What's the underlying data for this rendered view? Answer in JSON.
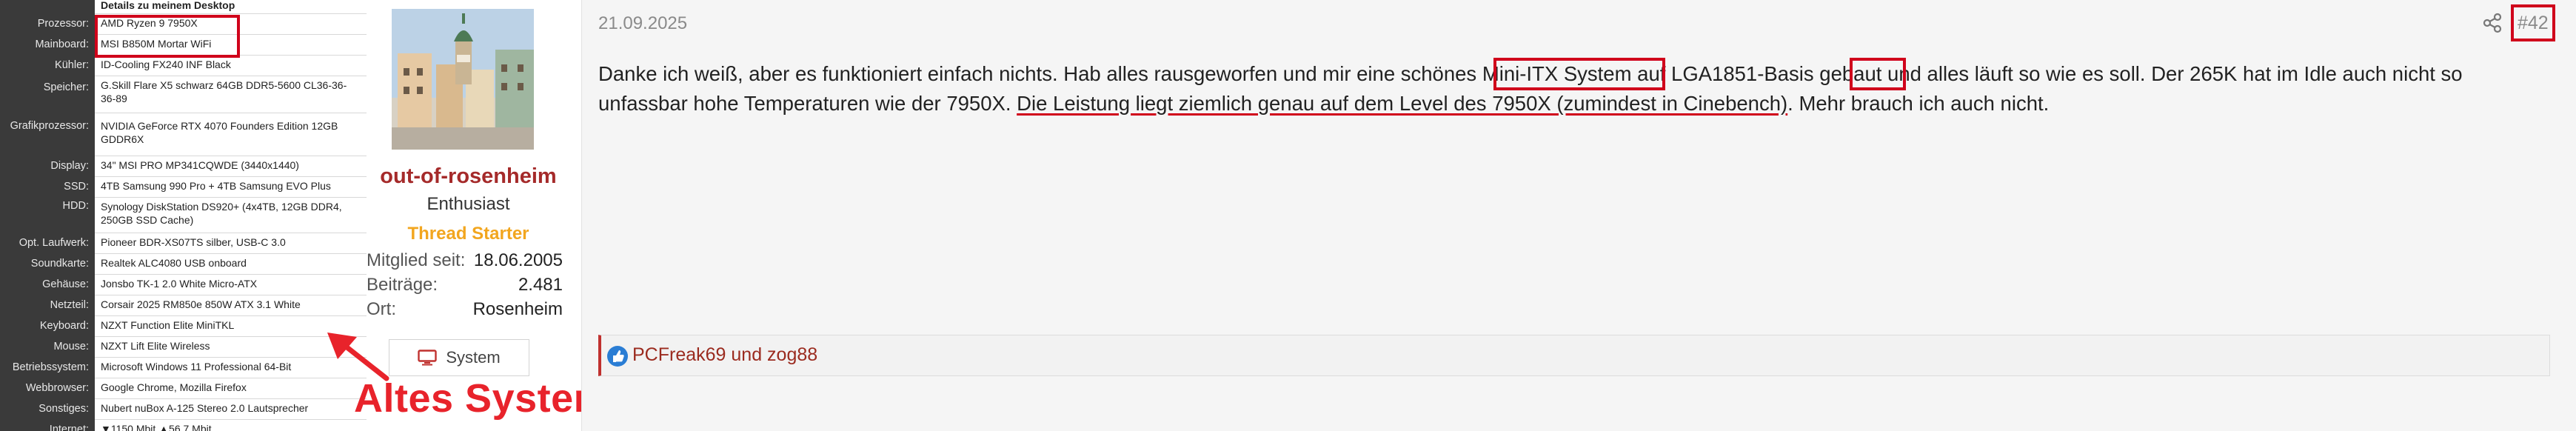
{
  "specs": {
    "header": "Details zu meinem Desktop",
    "rows": [
      {
        "label": "Prozessor:",
        "value": "AMD Ryzen 9 7950X"
      },
      {
        "label": "Mainboard:",
        "value": "MSI B850M Mortar WiFi"
      },
      {
        "label": "Kühler:",
        "value": "ID-Cooling FX240 INF Black"
      },
      {
        "label": "Speicher:",
        "value": "G.Skill Flare X5 schwarz 64GB DDR5-5600 CL36-36-36-89"
      },
      {
        "label": "Grafikprozessor:",
        "value": "NVIDIA GeForce RTX 4070 Founders Edition 12GB GDDR6X"
      },
      {
        "label": "Display:",
        "value": "34\" MSI PRO MP341CQWDE (3440x1440)"
      },
      {
        "label": "SSD:",
        "value": "4TB Samsung 990 Pro + 4TB Samsung EVO Plus"
      },
      {
        "label": "HDD:",
        "value": "Synology DiskStation DS920+ (4x4TB, 12GB DDR4, 250GB SSD Cache)"
      },
      {
        "label": "Opt. Laufwerk:",
        "value": "Pioneer BDR-XS07TS silber, USB-C 3.0"
      },
      {
        "label": "Soundkarte:",
        "value": "Realtek ALC4080 USB onboard"
      },
      {
        "label": "Gehäuse:",
        "value": "Jonsbo TK-1 2.0 White Micro-ATX"
      },
      {
        "label": "Netzteil:",
        "value": "Corsair 2025 RM850e 850W ATX 3.1 White"
      },
      {
        "label": "Keyboard:",
        "value": "NZXT Function Elite MiniTKL"
      },
      {
        "label": "Mouse:",
        "value": "NZXT Lift Elite Wireless"
      },
      {
        "label": "Betriebssystem:",
        "value": "Microsoft Windows 11 Professional 64-Bit"
      },
      {
        "label": "Webbrowser:",
        "value": "Google Chrome, Mozilla Firefox"
      },
      {
        "label": "Sonstiges:",
        "value": "Nubert nuBox A-125 Stereo 2.0 Lautsprecher"
      },
      {
        "label": "Internet:",
        "value": "▼1150 Mbit ▲56,7 Mbit"
      }
    ]
  },
  "annotation": {
    "text": "Altes System",
    "color": "#e8232b"
  },
  "user": {
    "avatar_icon": "avatar-image",
    "name": "out-of-rosenheim",
    "title": "Enthusiast",
    "badge": "Thread Starter",
    "stats": [
      {
        "label": "Mitglied seit:",
        "value": "18.06.2005"
      },
      {
        "label": "Beiträge:",
        "value": "2.481"
      },
      {
        "label": "Ort:",
        "value": "Rosenheim"
      }
    ],
    "system_button": "System",
    "system_icon": "monitor-icon"
  },
  "post": {
    "date": "21.09.2025",
    "number": "#42",
    "share_icon": "share-icon",
    "segments": {
      "s1": "Danke ich weiß, aber es funktioniert einfach nichts. Hab alles rausgeworfen und mir eine schönes ",
      "s2": "Mini-ITX System auf LGA1851-Basis",
      "s3": " gebaut und alles läuft so wie es soll. Der ",
      "s4": "265K",
      "s5": " hat im Idle auch nicht so unfassbar hohe Temperaturen wie der 7950X. ",
      "s6": "Die Leistung liegt ziemlich genau auf dem Level des 7950X (zumindest in Cinebench)",
      "s7": ". Mehr brauch ich auch nicht."
    },
    "reactions": "PCFreak69 und zog88",
    "reaction_icon": "thumbs-up-icon"
  },
  "colors": {
    "accent": "#a52a2a",
    "badge": "#f2a61f",
    "annotation": "#d0021b"
  }
}
